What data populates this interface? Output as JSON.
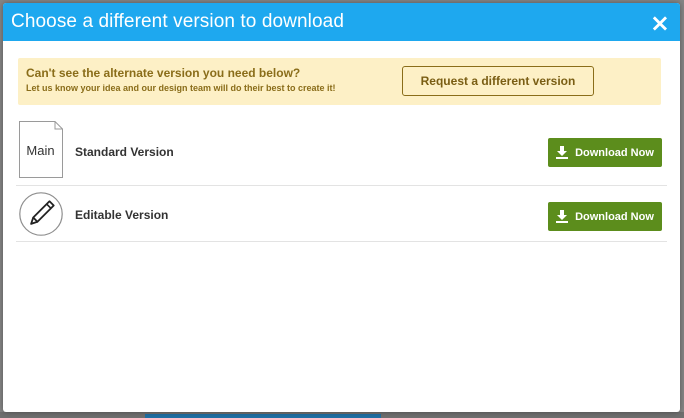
{
  "modal": {
    "title": "Choose a different version to download",
    "close_icon": "×"
  },
  "notice": {
    "title": "Can't see the alternate version you need below?",
    "subtitle": "Let us know your idea and our design team will do their best to create it!",
    "request_button": "Request a different version"
  },
  "versions": [
    {
      "thumb_label": "Main",
      "name": "Standard Version",
      "download_label": "Download Now",
      "icon": "document-icon"
    },
    {
      "name": "Editable Version",
      "download_label": "Download Now",
      "icon": "pencil-icon"
    }
  ],
  "colors": {
    "header": "#1ea8ef",
    "notice_bg": "#fdf0c6",
    "notice_text": "#8a6d1a",
    "download_button": "#5c8d1c"
  }
}
